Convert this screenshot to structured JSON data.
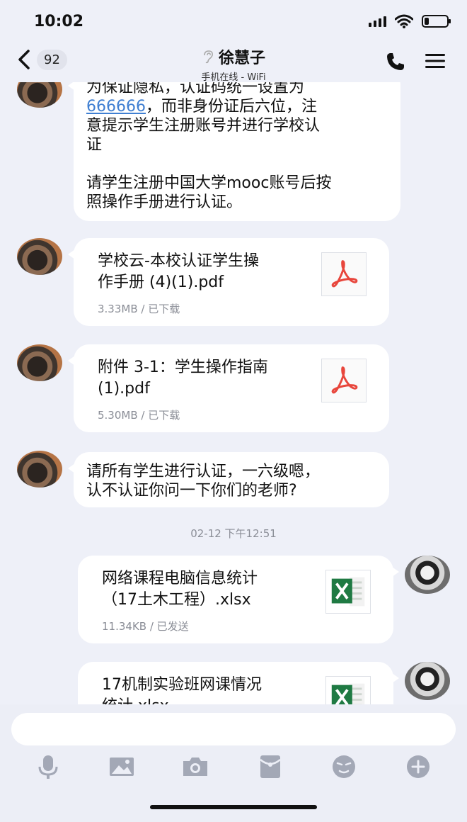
{
  "status_bar": {
    "time": "10:02",
    "icons": [
      "signal-icon",
      "wifi-icon",
      "battery-icon"
    ],
    "battery_level": 0.2
  },
  "header": {
    "back_count": "92",
    "contact_name": "徐慧子",
    "contact_status": "手机在线 - WiFi",
    "icons": [
      "back-chevron-icon",
      "ear-icon",
      "phone-icon",
      "menu-icon"
    ]
  },
  "messages": [
    {
      "side": "left",
      "type": "text",
      "lines": [
        "为保证隐私，认证码统一设置为",
        "666666",
        "，而非身份证后六位，注",
        "意提示学生注册账号并进行学校认",
        "证",
        "请学生注册中国大学mooc账号后按",
        "照操作手册进行认证。"
      ]
    },
    {
      "side": "left",
      "type": "file",
      "name_lines": [
        "学校云-本校认证学生操",
        "作手册 (4)(1).pdf"
      ],
      "meta": "3.33MB / 已下载",
      "icon": "pdf-icon"
    },
    {
      "side": "left",
      "type": "file",
      "name_lines": [
        "附件 3-1：学生操作指南",
        "(1).pdf"
      ],
      "meta": "5.30MB / 已下载",
      "icon": "pdf-icon"
    },
    {
      "side": "left",
      "type": "text",
      "lines": [
        "请所有学生进行认证，一六级嗯，",
        "认不认证你问一下你们的老师?"
      ]
    },
    {
      "type": "timestamp",
      "text": "02-12 下午12:51"
    },
    {
      "side": "right",
      "type": "file",
      "name_lines": [
        "网络课程电脑信息统计",
        "（17土木工程）.xlsx"
      ],
      "meta": "11.34KB / 已发送",
      "icon": "xlsx-icon"
    },
    {
      "side": "right",
      "type": "file",
      "name_lines": [
        "17机制实验班网课情况",
        "统计.xlsx"
      ],
      "meta": "",
      "icon": "xlsx-icon"
    }
  ],
  "input": {
    "placeholder": ""
  },
  "toolbar": [
    "microphone-icon",
    "image-icon",
    "camera-icon",
    "red-packet-icon",
    "emoji-icon",
    "plus-icon"
  ],
  "colors": {
    "background": "#eef0f8",
    "bubble": "#ffffff",
    "link": "#3f7fd2",
    "meta": "#8a8d96",
    "pdf_red": "#e8463c",
    "excel_green": "#1f7a43"
  }
}
